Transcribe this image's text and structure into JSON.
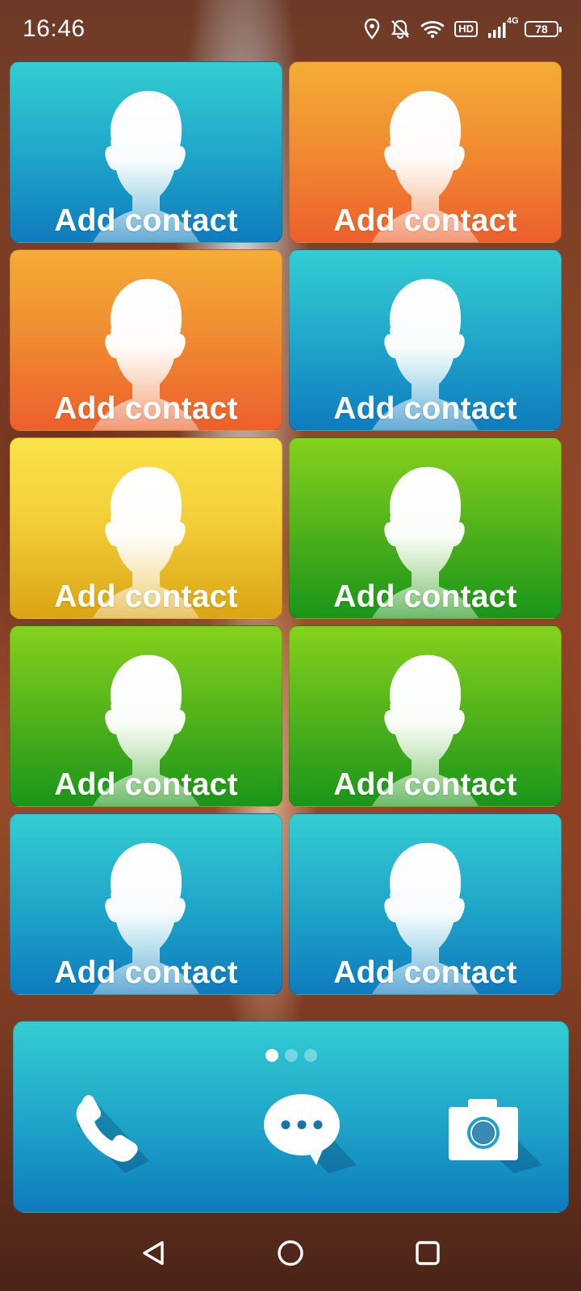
{
  "status_bar": {
    "time": "16:46",
    "hd_label": "HD",
    "network_label": "4G",
    "battery_level": "78",
    "icons": [
      "location-icon",
      "bell-off-icon",
      "wifi-icon",
      "hd-icon",
      "signal-icon",
      "battery-icon"
    ]
  },
  "contacts": [
    {
      "label": "Add contact",
      "color": "blue"
    },
    {
      "label": "Add contact",
      "color": "orange"
    },
    {
      "label": "Add contact",
      "color": "orange"
    },
    {
      "label": "Add contact",
      "color": "blue"
    },
    {
      "label": "Add contact",
      "color": "yellow"
    },
    {
      "label": "Add contact",
      "color": "green"
    },
    {
      "label": "Add contact",
      "color": "green"
    },
    {
      "label": "Add contact",
      "color": "green"
    },
    {
      "label": "Add contact",
      "color": "blue"
    },
    {
      "label": "Add contact",
      "color": "blue"
    }
  ],
  "colors": {
    "blue": "#1ea3c8",
    "orange": "#f08a31",
    "yellow": "#f2cf38",
    "green": "#52b21b"
  },
  "dock": {
    "page_count": 3,
    "active_page": 1,
    "apps": [
      {
        "name": "phone-icon"
      },
      {
        "name": "messages-icon"
      },
      {
        "name": "camera-icon"
      }
    ]
  },
  "nav_bar": {
    "buttons": [
      "back-icon",
      "home-icon",
      "recents-icon"
    ]
  }
}
